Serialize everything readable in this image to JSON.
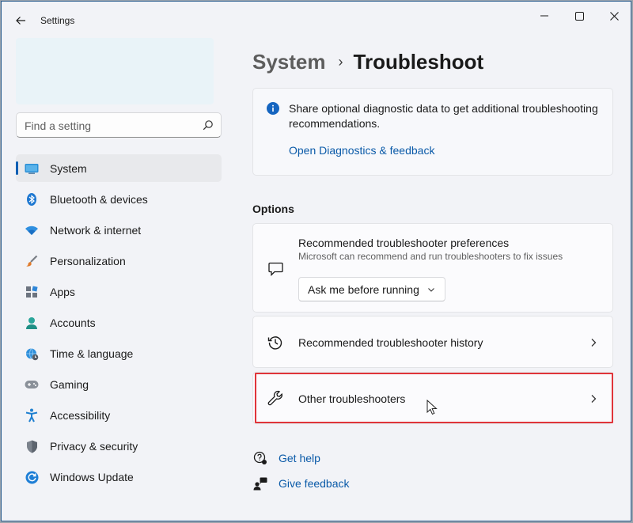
{
  "window": {
    "app_title": "Settings",
    "controls": [
      "minimize-icon",
      "maximize-icon",
      "close-icon"
    ]
  },
  "search": {
    "placeholder": "Find a setting"
  },
  "sidebar": {
    "items": [
      {
        "label": "System",
        "icon": "monitor-icon",
        "active": true
      },
      {
        "label": "Bluetooth & devices",
        "icon": "bluetooth-icon"
      },
      {
        "label": "Network & internet",
        "icon": "wifi-icon"
      },
      {
        "label": "Personalization",
        "icon": "brush-icon"
      },
      {
        "label": "Apps",
        "icon": "apps-icon"
      },
      {
        "label": "Accounts",
        "icon": "person-icon"
      },
      {
        "label": "Time & language",
        "icon": "globe-clock-icon"
      },
      {
        "label": "Gaming",
        "icon": "gamepad-icon"
      },
      {
        "label": "Accessibility",
        "icon": "accessibility-icon"
      },
      {
        "label": "Privacy & security",
        "icon": "shield-icon"
      },
      {
        "label": "Windows Update",
        "icon": "update-icon"
      }
    ]
  },
  "breadcrumb": {
    "parent": "System",
    "separator": "›",
    "current": "Troubleshoot"
  },
  "info": {
    "text": "Share optional diagnostic data to get additional troubleshooting recommendations.",
    "link": "Open Diagnostics & feedback"
  },
  "options": {
    "title": "Options",
    "pref_title": "Recommended troubleshooter preferences",
    "pref_subtitle": "Microsoft can recommend and run troubleshooters to fix issues",
    "pref_dropdown_value": "Ask me before running",
    "history_title": "Recommended troubleshooter history",
    "other_title": "Other troubleshooters"
  },
  "help": {
    "get_help": "Get help",
    "give_feedback": "Give feedback"
  },
  "colors": {
    "accent": "#0a5fb4",
    "link": "#0a5aa8",
    "highlight": "#e0343a"
  }
}
